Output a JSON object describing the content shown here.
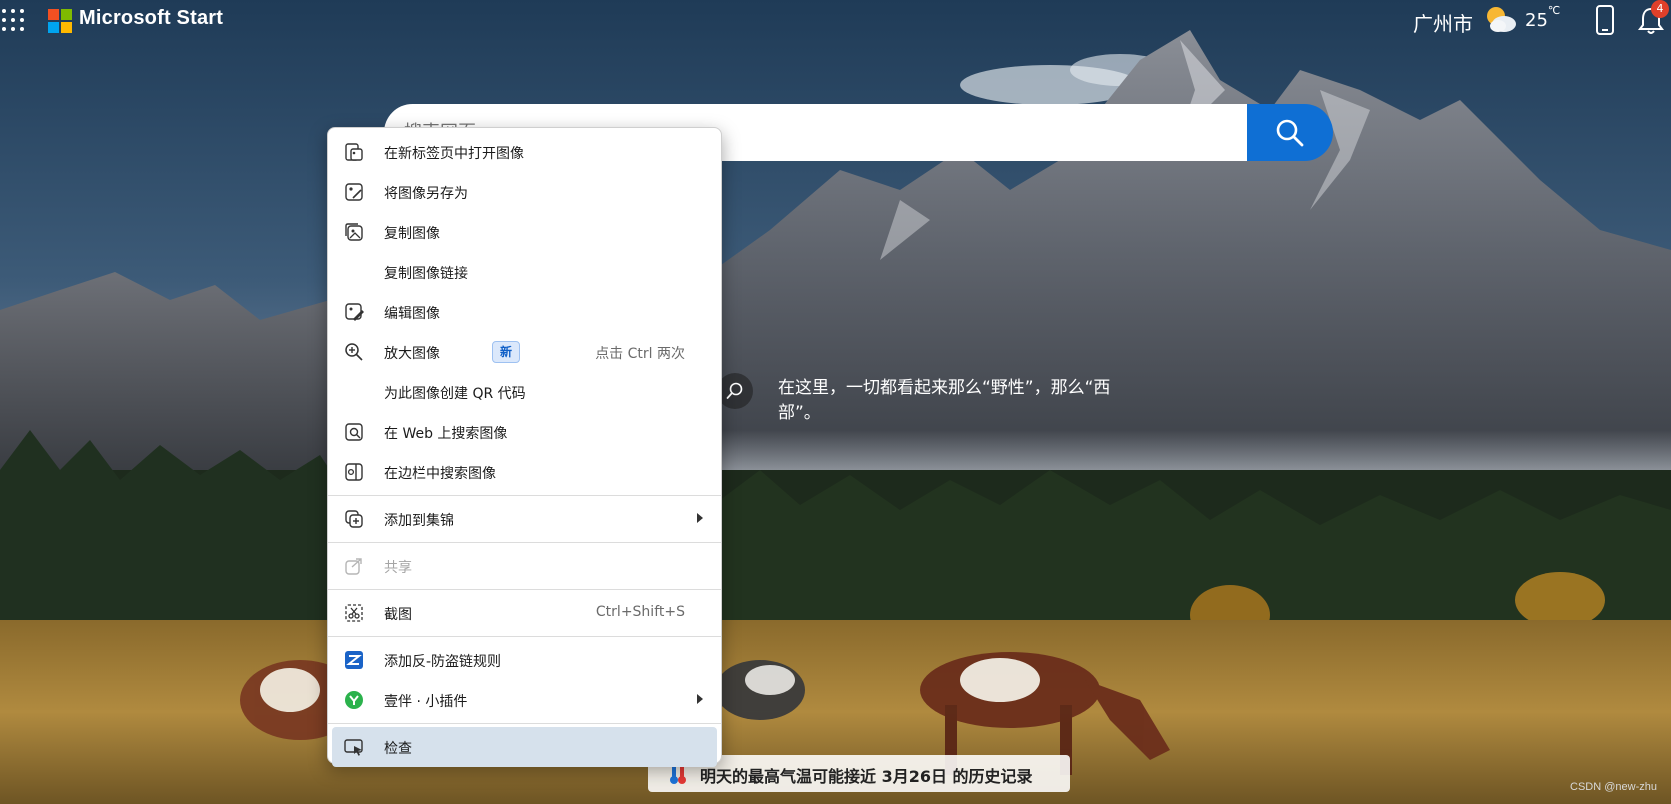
{
  "header": {
    "brand": "Microsoft Start",
    "city": "广州市",
    "temperature": "25",
    "temperature_unit": "℃",
    "notification_count": "4",
    "icons": [
      "apps-grid-icon",
      "microsoft-logo-icon",
      "weather-partly-cloudy-icon",
      "phone-icon",
      "bell-icon"
    ]
  },
  "search": {
    "placeholder": "搜索网页",
    "button_icon": "search-icon"
  },
  "caption": {
    "text": "在这里，一切都看起来那么“野性”，那么“西部”。",
    "icon": "search-icon"
  },
  "banner": {
    "text": "明天的最高气温可能接近 3月26日 的历史记录",
    "icon": "thermometer-icon"
  },
  "watermark": "CSDN @new-zhu",
  "context_menu": {
    "items": [
      {
        "label": "在新标签页中打开图像",
        "icon": "open-image-new-tab-icon"
      },
      {
        "label": "将图像另存为",
        "icon": "save-image-icon"
      },
      {
        "label": "复制图像",
        "icon": "copy-image-icon"
      },
      {
        "label": "复制图像链接",
        "icon": ""
      },
      {
        "label": "编辑图像",
        "icon": "edit-image-icon"
      },
      {
        "label": "放大图像",
        "icon": "zoom-in-icon",
        "badge": "新",
        "shortcut": "点击 Ctrl 两次"
      },
      {
        "label": "为此图像创建 QR 代码",
        "icon": ""
      },
      {
        "label": "在 Web 上搜索图像",
        "icon": "visual-search-icon"
      },
      {
        "label": "在边栏中搜索图像",
        "icon": "sidebar-search-icon"
      },
      {
        "label": "添加到集锦",
        "icon": "collections-icon",
        "submenu": true
      },
      {
        "label": "共享",
        "icon": "share-icon",
        "disabled": true
      },
      {
        "label": "截图",
        "icon": "screenshot-icon",
        "shortcut": "Ctrl+Shift+S"
      },
      {
        "label": "添加反-防盗链规则",
        "icon": "extension-z-icon"
      },
      {
        "label": "壹伴 · 小插件",
        "icon": "extension-yiban-icon",
        "submenu": true
      },
      {
        "label": "检查",
        "icon": "inspect-icon",
        "active": true
      }
    ]
  },
  "colors": {
    "search_button": "#0f6fd4",
    "menu_active": "#d6e1ec",
    "badge_bg": "#dbe8fb",
    "badge_text": "#0f5fc7",
    "notification_badge": "#e0402a"
  }
}
